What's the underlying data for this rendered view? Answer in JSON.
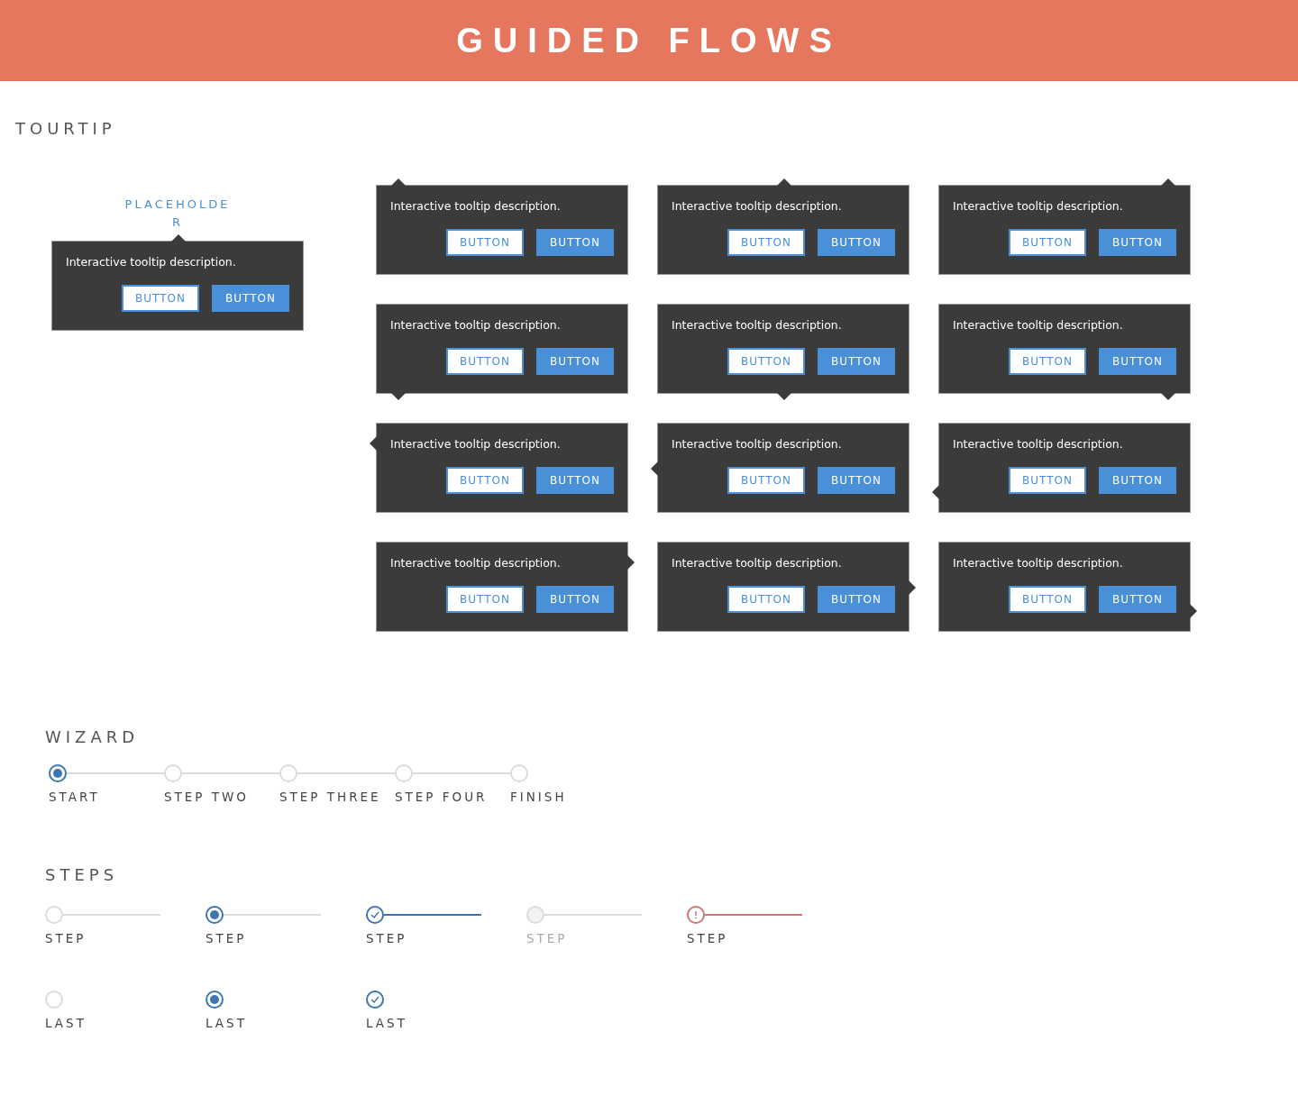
{
  "header": {
    "title": "GUIDED FLOWS"
  },
  "tourtip": {
    "heading": "TOURTIP",
    "standalone": {
      "placeholder_label": "PLACEHOLDER",
      "description": "Interactive tooltip description.",
      "kind": "top-center",
      "buttons": [
        {
          "label": "BUTTON",
          "kind": "outline"
        },
        {
          "label": "BUTTON",
          "kind": "filled"
        }
      ]
    },
    "tooltips": [
      {
        "description": "Interactive tooltip description.",
        "kind": "top-left",
        "buttons": [
          {
            "label": "BUTTON",
            "kind": "outline"
          },
          {
            "label": "BUTTON",
            "kind": "filled"
          }
        ]
      },
      {
        "description": "Interactive tooltip description.",
        "kind": "top-center",
        "buttons": [
          {
            "label": "BUTTON",
            "kind": "outline"
          },
          {
            "label": "BUTTON",
            "kind": "filled"
          }
        ]
      },
      {
        "description": "Interactive tooltip description.",
        "kind": "top-right",
        "buttons": [
          {
            "label": "BUTTON",
            "kind": "outline"
          },
          {
            "label": "BUTTON",
            "kind": "filled"
          }
        ]
      },
      {
        "description": "Interactive tooltip description.",
        "kind": "bottom-left",
        "buttons": [
          {
            "label": "BUTTON",
            "kind": "outline"
          },
          {
            "label": "BUTTON",
            "kind": "filled"
          }
        ]
      },
      {
        "description": "Interactive tooltip description.",
        "kind": "bottom-center",
        "buttons": [
          {
            "label": "BUTTON",
            "kind": "outline"
          },
          {
            "label": "BUTTON",
            "kind": "filled"
          }
        ]
      },
      {
        "description": "Interactive tooltip description.",
        "kind": "bottom-right",
        "buttons": [
          {
            "label": "BUTTON",
            "kind": "outline"
          },
          {
            "label": "BUTTON",
            "kind": "filled"
          }
        ]
      },
      {
        "description": "Interactive tooltip description.",
        "kind": "left-top",
        "buttons": [
          {
            "label": "BUTTON",
            "kind": "outline"
          },
          {
            "label": "BUTTON",
            "kind": "filled"
          }
        ]
      },
      {
        "description": "Interactive tooltip description.",
        "kind": "left-center",
        "buttons": [
          {
            "label": "BUTTON",
            "kind": "outline"
          },
          {
            "label": "BUTTON",
            "kind": "filled"
          }
        ]
      },
      {
        "description": "Interactive tooltip description.",
        "kind": "left-bottom",
        "buttons": [
          {
            "label": "BUTTON",
            "kind": "outline"
          },
          {
            "label": "BUTTON",
            "kind": "filled"
          }
        ]
      },
      {
        "description": "Interactive tooltip description.",
        "kind": "right-top",
        "buttons": [
          {
            "label": "BUTTON",
            "kind": "outline"
          },
          {
            "label": "BUTTON",
            "kind": "filled"
          }
        ]
      },
      {
        "description": "Interactive tooltip description.",
        "kind": "right-center",
        "buttons": [
          {
            "label": "BUTTON",
            "kind": "outline"
          },
          {
            "label": "BUTTON",
            "kind": "filled"
          }
        ]
      },
      {
        "description": "Interactive tooltip description.",
        "kind": "right-bottom",
        "buttons": [
          {
            "label": "BUTTON",
            "kind": "outline"
          },
          {
            "label": "BUTTON",
            "kind": "filled"
          }
        ]
      }
    ]
  },
  "wizard": {
    "heading": "WIZARD",
    "steps": [
      {
        "label": "START",
        "selected": true
      },
      {
        "label": "STEP TWO",
        "selected": false
      },
      {
        "label": "STEP THREE",
        "selected": false
      },
      {
        "label": "STEP FOUR",
        "selected": false
      },
      {
        "label": "FINISH",
        "selected": false
      }
    ]
  },
  "steps": {
    "heading": "STEPS",
    "rows": [
      [
        {
          "label": "STEP",
          "kind": "default",
          "connector": true
        },
        {
          "label": "STEP",
          "kind": "active",
          "connector": true
        },
        {
          "label": "STEP",
          "kind": "done",
          "connector": true
        },
        {
          "label": "STEP",
          "kind": "disabled",
          "connector": true
        },
        {
          "label": "STEP",
          "kind": "error",
          "connector": true
        }
      ],
      [
        {
          "label": "LAST",
          "kind": "default",
          "connector": false
        },
        {
          "label": "LAST",
          "kind": "active",
          "connector": false
        },
        {
          "label": "LAST",
          "kind": "done",
          "connector": false
        }
      ]
    ]
  }
}
